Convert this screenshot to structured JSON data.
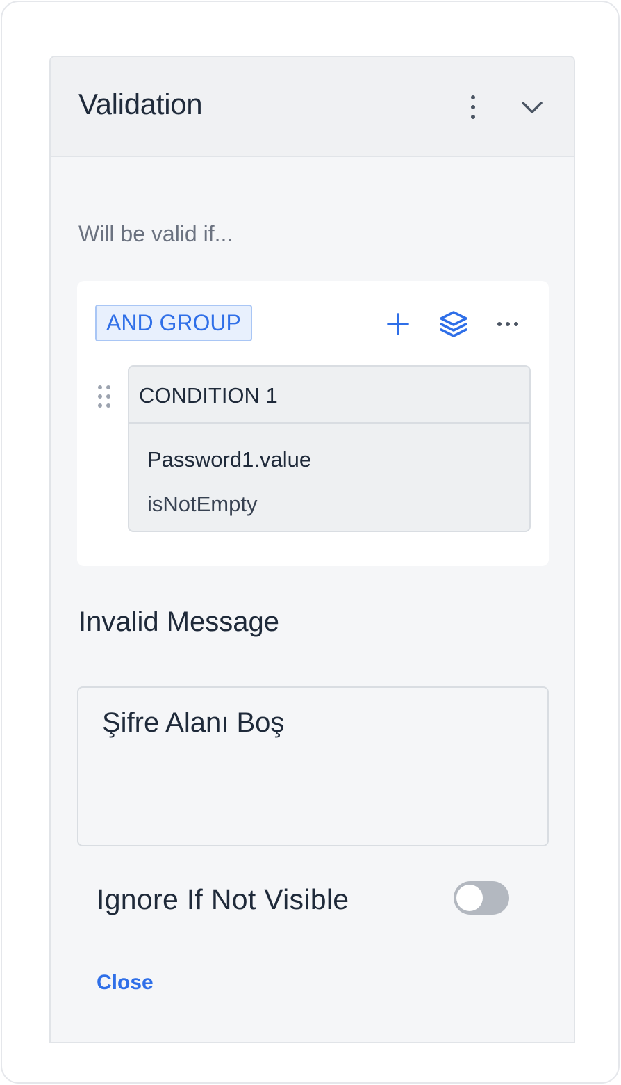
{
  "panel": {
    "title": "Validation",
    "subtitle": "Will be valid if...",
    "menu_icon": "kebab-vertical-icon",
    "collapse_icon": "chevron-down-icon"
  },
  "group": {
    "badge_label": "AND GROUP",
    "actions": [
      "plus-icon",
      "layers-icon",
      "more-horizontal-icon"
    ],
    "conditions": [
      {
        "title": "CONDITION 1",
        "field": "Password1.value",
        "operator": "isNotEmpty"
      }
    ]
  },
  "invalid_message": {
    "label": "Invalid Message",
    "value": "Şifre Alanı Boş"
  },
  "ignore_if_not_visible": {
    "label": "Ignore If Not Visible",
    "enabled": false
  },
  "footer": {
    "close_label": "Close"
  },
  "colors": {
    "accent": "#2f6fe8",
    "text": "#1f2a3a",
    "muted": "#6b7280",
    "toggle_off": "#b3b8c0"
  }
}
